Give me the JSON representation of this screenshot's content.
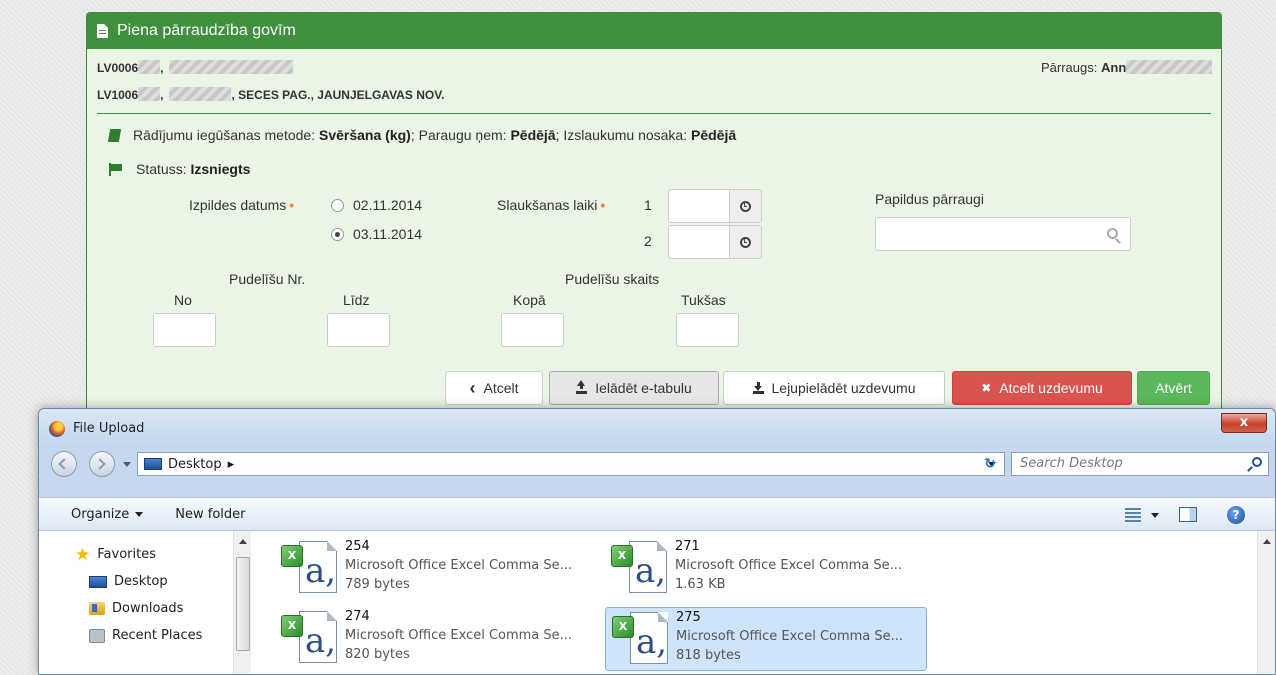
{
  "panel": {
    "title": "Piena pārraudzība govīm",
    "addr_line1_a": "LV0006",
    "addr_line1_b": ",",
    "addr_line2_a": "LV1006",
    "addr_line2_b": ",",
    "addr_line2_c": ", SECES PAG., JAUNJELGAVAS NOV.",
    "supervisor_label": "Pārraugs:",
    "supervisor_name": "Ann",
    "method_label": "Rādījumu iegūšanas metode:",
    "method_value": "Svēršana (kg)",
    "sample_label": "; Paraugu ņem:",
    "sample_value": "Pēdējā",
    "milk_label": "; Izslaukumu nosaka:",
    "milk_value": "Pēdējā",
    "status_label": "Statuss:",
    "status_value": "Izsniegts",
    "date_label": "Izpildes datums",
    "date_option_1": "02.11.2014",
    "date_option_2": "03.11.2014",
    "milking_label": "Slaukšanas laiki",
    "milking_1": "1",
    "milking_2": "2",
    "extra_supervisors_label": "Papildus pārraugi",
    "bottle_nr_label": "Pudelīšu Nr.",
    "from_label": "No",
    "to_label": "Līdz",
    "bottle_count_label": "Pudelīšu skaits",
    "total_label": "Kopā",
    "empty_label": "Tukšas",
    "required_mark": "•"
  },
  "buttons": {
    "cancel": "Atcelt",
    "upload": "Ielādēt e-tabulu",
    "download": "Lejupielādēt uzdevumu",
    "cancel_task": "Atcelt uzdevumu",
    "open": "Atvērt",
    "cancel_icon": "‹",
    "cancel_task_icon": "✖"
  },
  "dialog": {
    "title": "File Upload",
    "close": "x",
    "location": "Desktop",
    "location_arrow": "▸",
    "refresh": "↻",
    "search_placeholder": "Search Desktop",
    "organize": "Organize",
    "new_folder": "New folder",
    "help": "?",
    "nav": [
      {
        "label": "Favorites",
        "icon": "star-icon"
      },
      {
        "label": "Desktop",
        "icon": "desktop-icon"
      },
      {
        "label": "Downloads",
        "icon": "downloads-icon"
      },
      {
        "label": "Recent Places",
        "icon": "recent-places-icon"
      }
    ],
    "files": [
      {
        "name": "254",
        "type": "Microsoft Office Excel Comma Se...",
        "size": "789 bytes"
      },
      {
        "name": "271",
        "type": "Microsoft Office Excel Comma Se...",
        "size": "1.63 KB"
      },
      {
        "name": "274",
        "type": "Microsoft Office Excel Comma Se...",
        "size": "820 bytes"
      },
      {
        "name": "275",
        "type": "Microsoft Office Excel Comma Se...",
        "size": "818 bytes"
      }
    ],
    "file_icon_letter": "a,",
    "excel_badge": "X"
  },
  "colors": {
    "panel_header": "#3f8f3f",
    "panel_bg": "#ebf5e6",
    "required": "#f0883a",
    "danger": "#d9534f",
    "success": "#5cb85c"
  }
}
